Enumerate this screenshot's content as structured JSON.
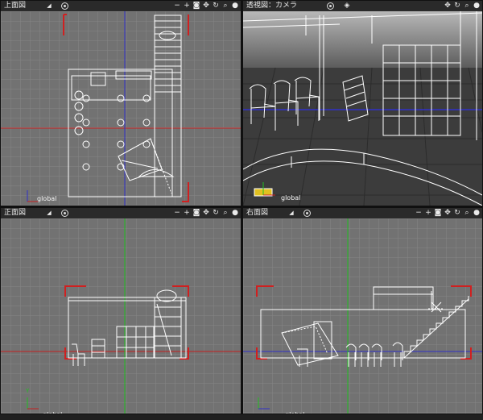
{
  "viewports": {
    "top": {
      "title": "上面図"
    },
    "perspective": {
      "title": "透視図：カメラ"
    },
    "front": {
      "title": "正面図"
    },
    "right": {
      "title": "右面図"
    }
  },
  "coord_label": "global",
  "axis_y": "Y",
  "tool_icons": [
    "minus-icon",
    "plus-icon",
    "camera-icon",
    "pan-icon",
    "rotate-icon",
    "zoom-icon",
    "sphere-icon"
  ],
  "colors": {
    "grid_bg": "#727272",
    "grid_line": "#868686",
    "axis_red": "#c42020",
    "axis_blue": "#3030c8",
    "axis_green": "#20c020",
    "wire": "#ffffff",
    "header": "#2a2a2a"
  }
}
